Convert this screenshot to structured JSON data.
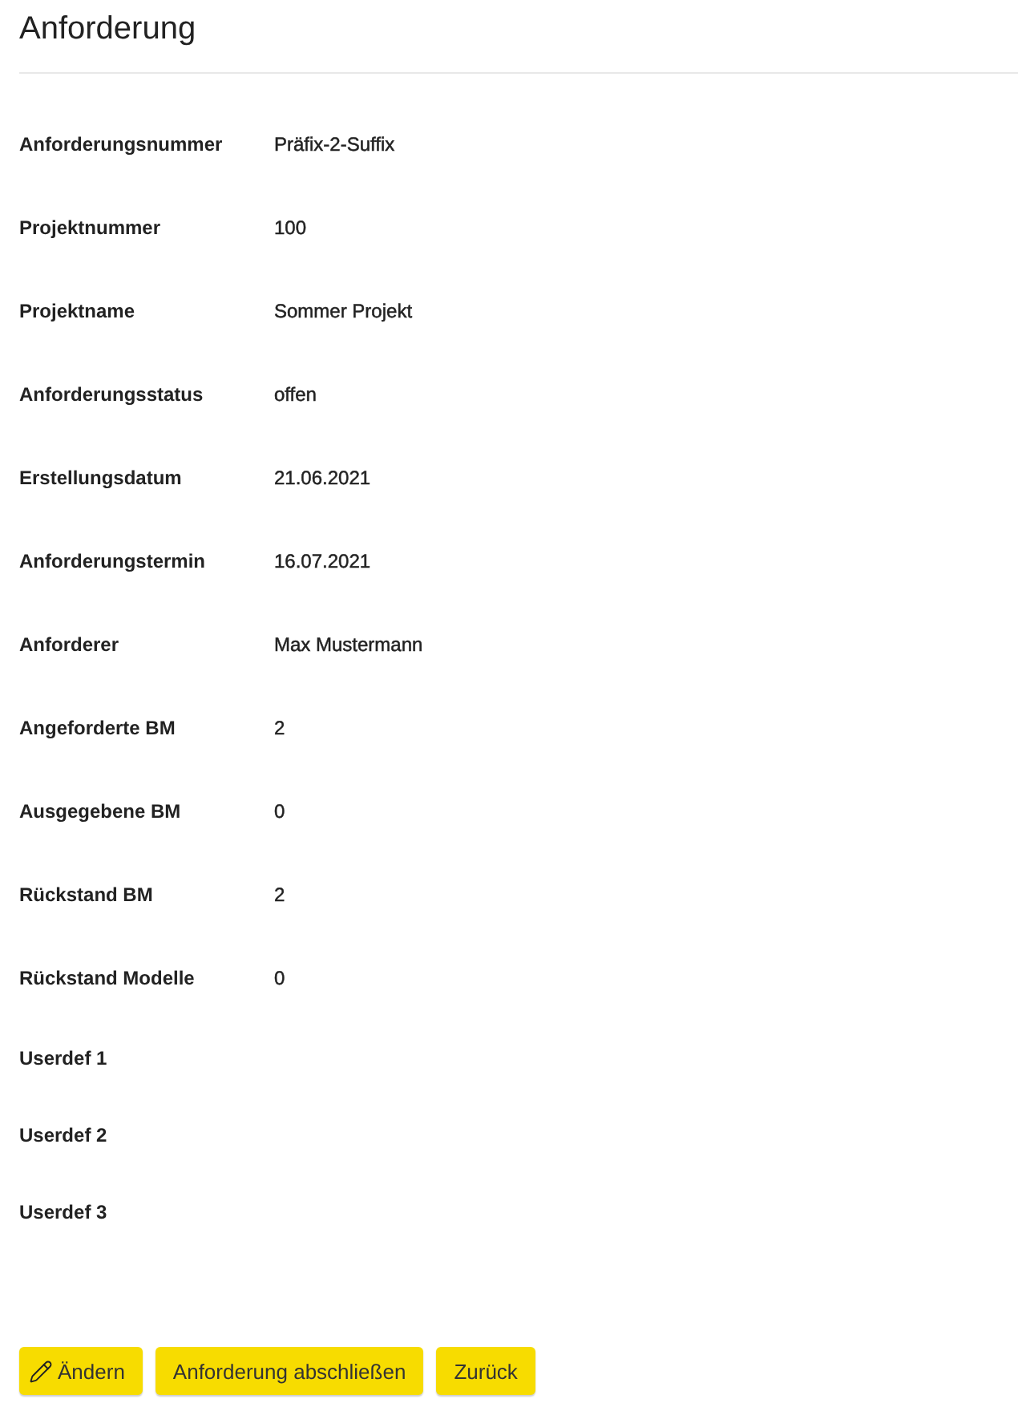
{
  "title": "Anforderung",
  "fields": [
    {
      "label": "Anforderungsnummer",
      "value": "Präfix-2-Suffix"
    },
    {
      "label": "Projektnummer",
      "value": "100"
    },
    {
      "label": "Projektname",
      "value": "Sommer Projekt"
    },
    {
      "label": "Anforderungsstatus",
      "value": "offen"
    },
    {
      "label": "Erstellungsdatum",
      "value": "21.06.2021"
    },
    {
      "label": "Anforderungstermin",
      "value": "16.07.2021"
    },
    {
      "label": "Anforderer",
      "value": "Max Mustermann"
    },
    {
      "label": "Angeforderte BM",
      "value": "2"
    },
    {
      "label": "Ausgegebene BM",
      "value": "0"
    },
    {
      "label": "Rückstand BM",
      "value": "2"
    },
    {
      "label": "Rückstand Modelle",
      "value": "0"
    },
    {
      "label": "Userdef 1"
    },
    {
      "label": "Userdef 2"
    },
    {
      "label": "Userdef 3"
    }
  ],
  "buttons": [
    {
      "kind": "edit",
      "label": "Ändern"
    },
    {
      "kind": "plain",
      "label": "Anforderung abschließen"
    },
    {
      "kind": "plain",
      "label": "Zurück"
    }
  ]
}
